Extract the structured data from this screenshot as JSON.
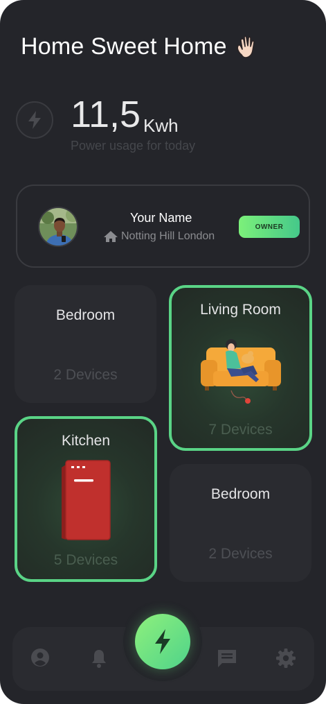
{
  "header": {
    "greeting": "Home Sweet Home",
    "greeting_icon": "waving-hand-icon"
  },
  "usage": {
    "value": "11,5",
    "unit": "Kwh",
    "label": "Power usage for today",
    "icon": "lightning-icon"
  },
  "profile": {
    "name": "Your Name",
    "location": "Notting Hill London",
    "location_icon": "home-icon",
    "badge": "OWNER"
  },
  "rooms": [
    {
      "title": "Bedroom",
      "devices": "2 Devices",
      "active": false
    },
    {
      "title": "Living Room",
      "devices": "7 Devices",
      "active": true,
      "illustration": "sofa-illustration"
    },
    {
      "title": "Kitchen",
      "devices": "5 Devices",
      "active": true,
      "illustration": "fridge-illustration"
    },
    {
      "title": "Bedroom",
      "devices": "2 Devices",
      "active": false
    }
  ],
  "nav": {
    "items": [
      "profile-icon",
      "bell-icon",
      "lightning-icon",
      "chat-icon",
      "gear-icon"
    ],
    "active": "lightning-icon"
  },
  "colors": {
    "background": "#24252a",
    "card": "#2a2b30",
    "accent": "#5ad486",
    "accent_gradient_start": "#7cf07a",
    "accent_gradient_end": "#45c88a",
    "fridge": "#c0302d",
    "sofa": "#f2a33a"
  }
}
